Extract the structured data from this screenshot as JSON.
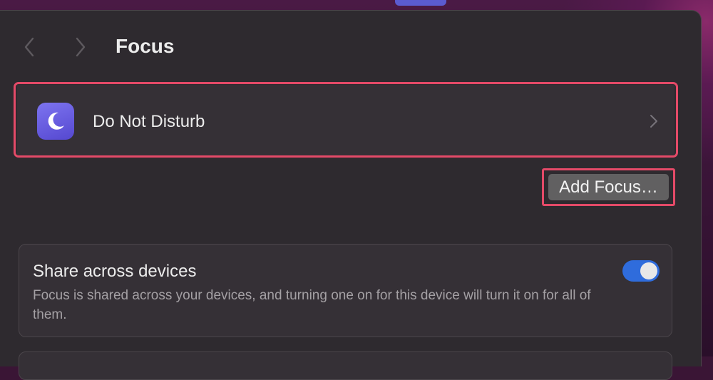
{
  "page": {
    "title": "Focus"
  },
  "nav": {
    "back_icon": "chevron-left-icon",
    "forward_icon": "chevron-right-icon"
  },
  "focus_modes": [
    {
      "label": "Do Not Disturb",
      "icon": "moon-icon",
      "icon_color": "#6a5fe6"
    }
  ],
  "actions": {
    "add_focus_label": "Add Focus…"
  },
  "share_setting": {
    "title": "Share across devices",
    "description": "Focus is shared across your devices, and turning one on for this device will turn it on for all of them.",
    "enabled": true
  },
  "colors": {
    "highlight": "#e44a68",
    "toggle_on": "#2f6cdc"
  }
}
